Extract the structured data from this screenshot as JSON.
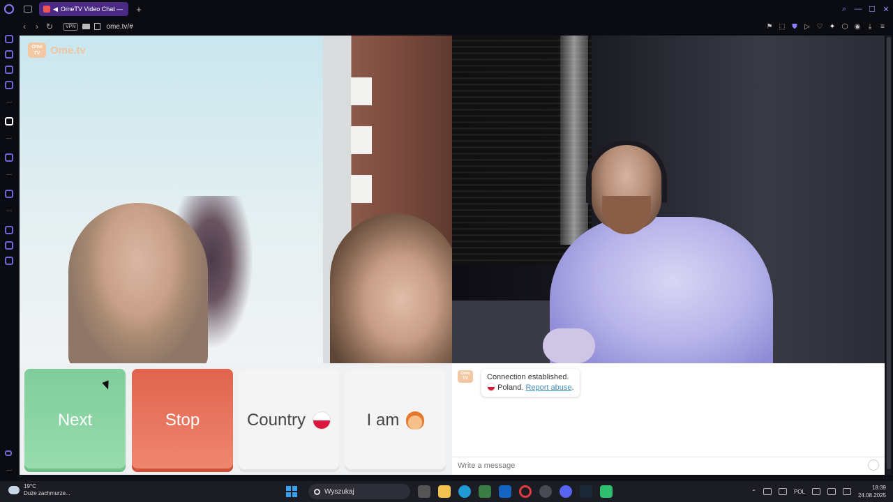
{
  "browser": {
    "tab_title": "OmeTV Video Chat —",
    "new_tab_label": "+",
    "url": "ome.tv/#",
    "vpn_label": "VPN"
  },
  "video": {
    "logo_small": "Ome TV",
    "logo_text": "Ome.tv"
  },
  "controls": {
    "next_label": "Next",
    "stop_label": "Stop",
    "country_label": "Country",
    "country_flag": "poland-flag",
    "iam_label": "I am",
    "iam_icon": "boy-emoji-icon"
  },
  "chat": {
    "logo_small": "Ome TV",
    "status": "Connection established.",
    "country": "Poland.",
    "report_link": "Report abuse",
    "report_suffix": ".",
    "input_placeholder": "Write a message"
  },
  "taskbar": {
    "temperature": "19°C",
    "weather_desc": "Duże zachmurze...",
    "search_placeholder": "Wyszukaj",
    "language": "POL",
    "time": "18:39",
    "date": "24.08.2025"
  },
  "colors": {
    "next": "#8fd6a6",
    "stop": "#e9735c",
    "accent": "#4b2a86",
    "link": "#3d8fbd"
  }
}
